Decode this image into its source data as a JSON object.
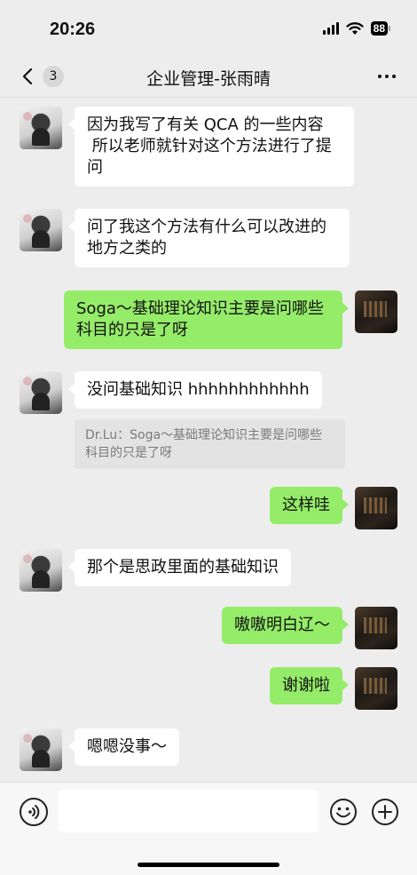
{
  "status_bar": {
    "time": "20:26",
    "battery": "88"
  },
  "nav": {
    "unread_count": "3",
    "title": "企业管理-张雨晴"
  },
  "messages": [
    {
      "side": "left",
      "text": "因为我写了有关 QCA 的一些内容\n 所以老师就针对这个方法进行了提问"
    },
    {
      "side": "left",
      "text": "问了我这个方法有什么可以改进的地方之类的"
    },
    {
      "side": "right",
      "text": "Soga～基础理论知识主要是问哪些科目的只是了呀"
    },
    {
      "side": "left",
      "text": "没问基础知识 hhhhhhhhhhhh",
      "quote": "Dr.Lu：Soga～基础理论知识主要是问哪些科目的只是了呀"
    },
    {
      "side": "right",
      "text": "这样哇"
    },
    {
      "side": "left",
      "text": "那个是思政里面的基础知识"
    },
    {
      "side": "right",
      "text": "嗷嗷明白辽～"
    },
    {
      "side": "right",
      "text": "谢谢啦"
    },
    {
      "side": "left",
      "text": "嗯嗯没事～"
    }
  ],
  "input": {
    "value": ""
  },
  "colors": {
    "background": "#ededed",
    "sent_bubble": "#95ec69",
    "received_bubble": "#ffffff"
  },
  "icons": {
    "back": "chevron-left-icon",
    "more": "more-icon",
    "voice": "voice-icon",
    "emoji": "emoji-icon",
    "plus": "plus-icon"
  }
}
